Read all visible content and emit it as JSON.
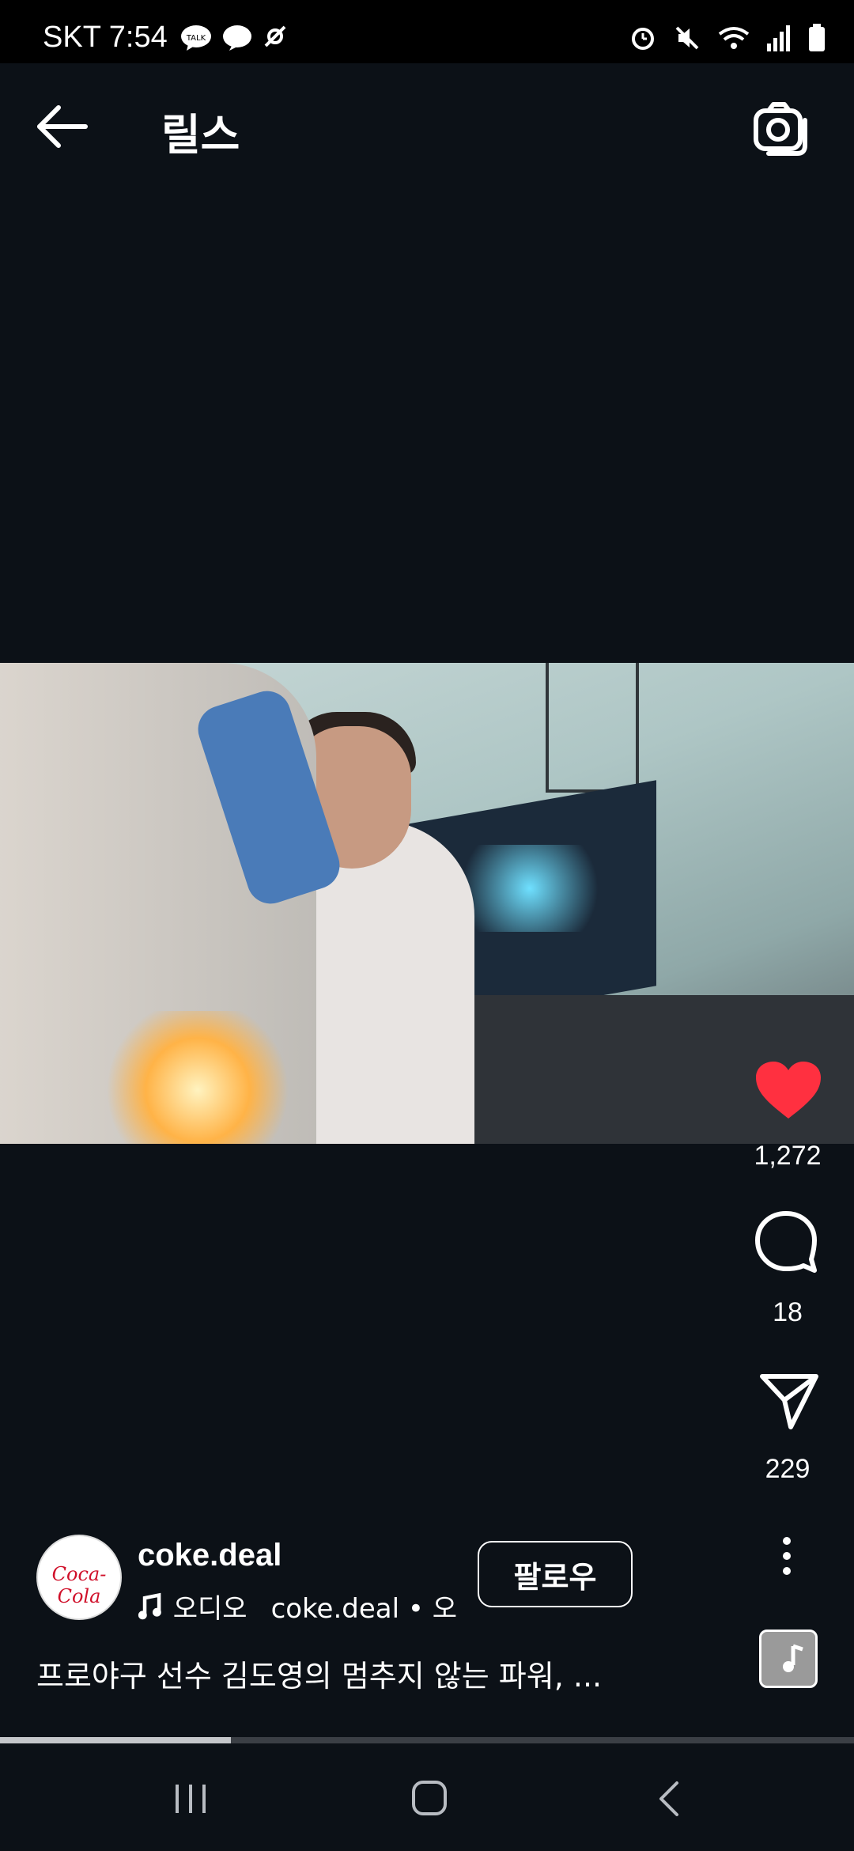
{
  "status_bar": {
    "carrier_time": "SKT 7:54",
    "left_icons": [
      "talk-icon",
      "chat-bubble-icon",
      "satellite-icon"
    ],
    "right_icons": [
      "alarm-icon",
      "mute-icon",
      "wifi-icon",
      "signal-icon",
      "battery-icon"
    ]
  },
  "header": {
    "title": "릴스",
    "back_icon": "arrow-left-icon",
    "camera_icon": "camera-icon"
  },
  "actions": {
    "like_count": "1,272",
    "comment_count": "18",
    "share_count": "229",
    "like_color": "#ff3040"
  },
  "account": {
    "username": "coke.deal",
    "avatar_logo": "Coca-Cola",
    "audio_text": "오디오",
    "audio_owner": "coke.deal • 오",
    "follow_label": "팔로우"
  },
  "caption": "프로야구 선수 김도영의 멈추지 않는 파워, ...",
  "progress": {
    "fraction": 0.27
  },
  "colors": {
    "background": "#0c1117",
    "status_bar": "#000000"
  }
}
